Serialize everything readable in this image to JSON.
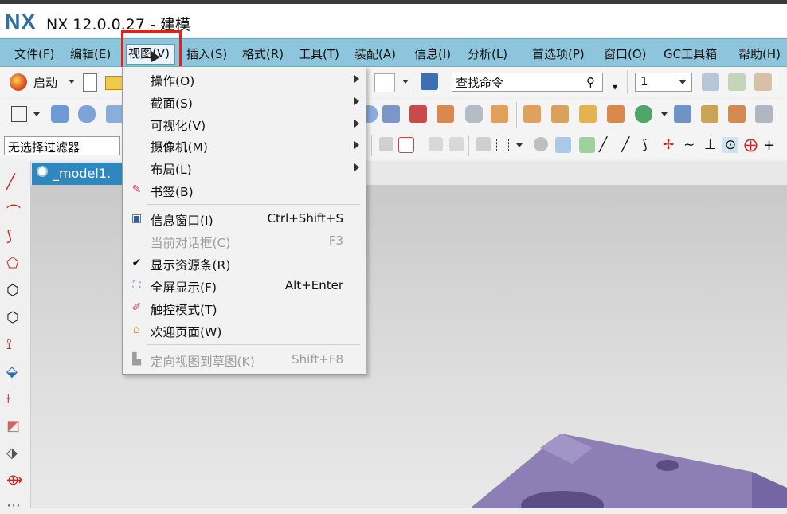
{
  "app": {
    "logo": "NX",
    "title": "NX 12.0.0.27 - 建模"
  },
  "menubar": {
    "items": [
      {
        "label": "文件(F)"
      },
      {
        "label": "编辑(E)"
      },
      {
        "label": "视图(V)"
      },
      {
        "label": "插入(S)"
      },
      {
        "label": "格式(R)"
      },
      {
        "label": "工具(T)"
      },
      {
        "label": "装配(A)"
      },
      {
        "label": "信息(I)"
      },
      {
        "label": "分析(L)"
      },
      {
        "label": "首选项(P)"
      },
      {
        "label": "窗口(O)"
      },
      {
        "label": "GC工具箱"
      },
      {
        "label": "帮助(H)"
      }
    ]
  },
  "toolbar": {
    "start_label": "启动",
    "search_placeholder": "查找命令",
    "number_value": "1",
    "filter_value": "无选择过滤器"
  },
  "tab": {
    "label": "_model1."
  },
  "view_menu": {
    "items": [
      {
        "label": "操作(O)",
        "submenu": true
      },
      {
        "label": "截面(S)",
        "submenu": true
      },
      {
        "label": "可视化(V)",
        "submenu": true
      },
      {
        "label": "摄像机(M)",
        "submenu": true
      },
      {
        "label": "布局(L)",
        "submenu": true
      },
      {
        "label": "书签(B)",
        "icon": "bookmark-icon"
      },
      {
        "label": "信息窗口(I)",
        "shortcut": "Ctrl+Shift+S",
        "icon": "info-window-icon"
      },
      {
        "label": "当前对话框(C)",
        "shortcut": "F3",
        "disabled": true
      },
      {
        "label": "显示资源条(R)",
        "checked": true
      },
      {
        "label": "全屏显示(F)",
        "shortcut": "Alt+Enter",
        "icon": "fullscreen-icon"
      },
      {
        "label": "触控模式(T)",
        "icon": "touch-mode-icon"
      },
      {
        "label": "欢迎页面(W)",
        "icon": "welcome-icon"
      },
      {
        "label": "定向视图到草图(K)",
        "shortcut": "Shift+F8",
        "disabled": true,
        "icon": "orient-view-icon"
      }
    ]
  },
  "colors": {
    "menubar": "#8dc6dc",
    "highlight_box": "#e0221c",
    "tab": "#2f88bd",
    "model": "#8d7fb5"
  }
}
